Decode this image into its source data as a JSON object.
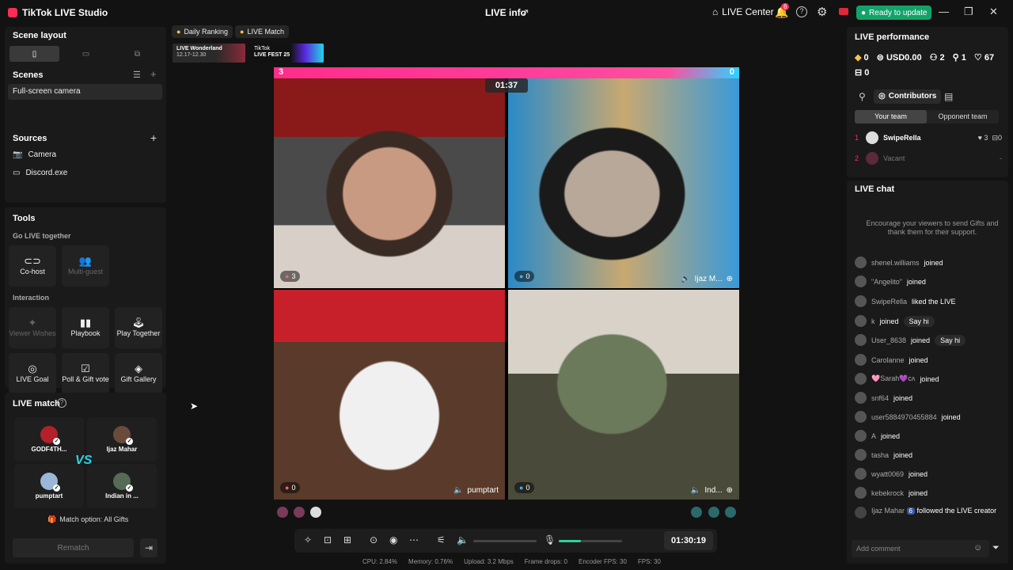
{
  "app": {
    "title": "TikTok LIVE Studio",
    "live_info": "LIVE info",
    "live_center": "LIVE Center",
    "notif_count": "6",
    "update": "Ready to update"
  },
  "left": {
    "scene_layout": "Scene layout",
    "scenes": "Scenes",
    "scene_item": "Full-screen camera",
    "sources": "Sources",
    "source_items": [
      "Camera",
      "Discord.exe"
    ],
    "tools": "Tools",
    "go_live_together": "Go LIVE together",
    "cohost": "Co-host",
    "multiguest": "Multi-guest",
    "interaction": "Interaction",
    "viewer_wishes": "Viewer Wishes",
    "playbook": "Playbook",
    "play_together": "Play Together",
    "live_goal": "LIVE Goal",
    "poll": "Poll & Gift vote",
    "gift_gallery": "Gift Gallery",
    "live_match": "LIVE match",
    "players": [
      "GODF4TH...",
      "Ijaz Mahar",
      "pumptart",
      "Indian in ..."
    ],
    "vs": "VS",
    "match_option": "Match option: All Gifts",
    "rematch": "Rematch"
  },
  "top": {
    "daily_ranking": "Daily Ranking",
    "live_match": "LIVE Match",
    "banner1_title": "LIVE Wonderland",
    "banner1_dates": "12.17-12.30",
    "banner2_brand": "TikTok",
    "banner2_title": "LIVE FEST 25"
  },
  "stage": {
    "score_left": "3",
    "score_right": "0",
    "timer": "01:37",
    "tiles": [
      {
        "gifts": "3",
        "name": ""
      },
      {
        "gifts": "0",
        "name": "Ijaz M..."
      },
      {
        "gifts": "0",
        "name": "pumptart"
      },
      {
        "gifts": "0",
        "name": "Ind..."
      }
    ]
  },
  "controls": {
    "elapsed": "01:30:19",
    "volume": 0.0,
    "mic": 0.35
  },
  "status": {
    "cpu": "CPU: 2.84%",
    "memory": "Memory: 0.76%",
    "upload": "Upload: 3.2 Mbps",
    "frame_drops": "Frame drops: 0",
    "encoder_fps": "Encoder FPS: 30",
    "fps": "FPS: 30"
  },
  "right": {
    "performance": "LIVE performance",
    "coins": "0",
    "usd": "USD0.00",
    "viewers": "2",
    "new_followers": "1",
    "likes": "67",
    "gifts_box": "0",
    "contributors": "Contributors",
    "your_team": "Your team",
    "opponent_team": "Opponent team",
    "contrib1_rank": "1",
    "contrib1_name": "SwipeRella",
    "contrib1_likes": "3",
    "contrib1_gifts": "0",
    "contrib2_rank": "2",
    "contrib2_name": "Vacant",
    "contrib2_dash": "-",
    "live_chat": "LIVE chat",
    "encourage": "Encourage your viewers to send Gifts and thank them for their support.",
    "chat": [
      {
        "user": "shenel.williams",
        "action": "joined",
        "sayhi": ""
      },
      {
        "user": "\"Angelito\"",
        "action": "joined",
        "sayhi": ""
      },
      {
        "user": "SwipeRella",
        "action": "liked the LIVE",
        "sayhi": ""
      },
      {
        "user": "k",
        "action": "joined",
        "sayhi": "Say hi"
      },
      {
        "user": "User_8638",
        "action": "joined",
        "sayhi": "Say hi"
      },
      {
        "user": "Carolanne",
        "action": "joined",
        "sayhi": ""
      },
      {
        "user": "🩷Sarah💜cʌ",
        "action": "joined",
        "sayhi": ""
      },
      {
        "user": "snf64",
        "action": "joined",
        "sayhi": ""
      },
      {
        "user": "user5884970455884",
        "action": "joined",
        "sayhi": ""
      },
      {
        "user": "A",
        "action": "joined",
        "sayhi": ""
      },
      {
        "user": "tasha",
        "action": "joined",
        "sayhi": ""
      },
      {
        "user": "wyatt0069",
        "action": "joined",
        "sayhi": ""
      },
      {
        "user": "kebekrock",
        "action": "joined",
        "sayhi": ""
      }
    ],
    "last_user": "Ijaz Mahar",
    "last_level": "6",
    "last_action": "followed the LIVE creator",
    "add_comment": "Add comment"
  }
}
